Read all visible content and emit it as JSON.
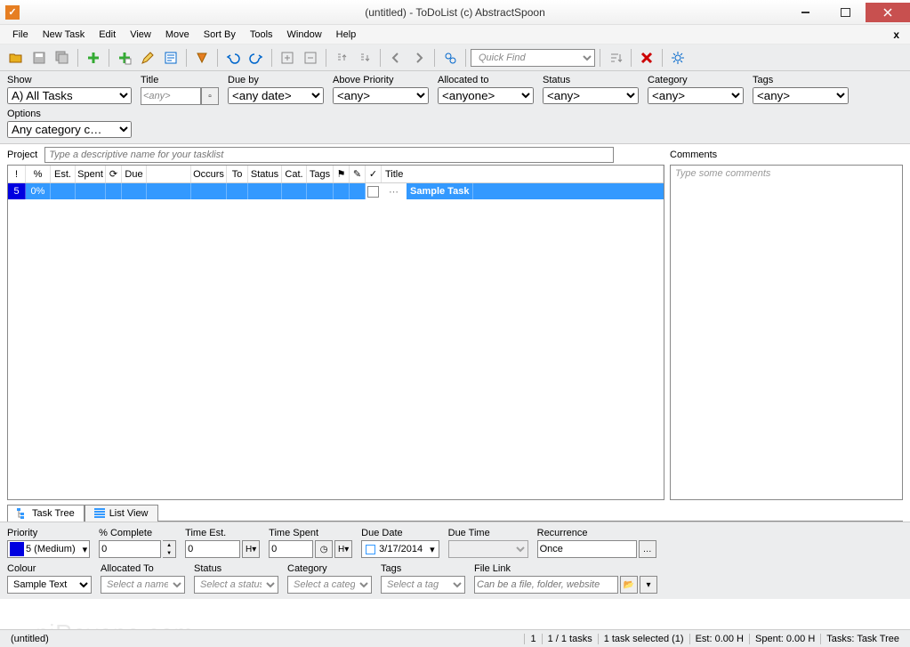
{
  "window": {
    "title": "(untitled) - ToDoList (c) AbstractSpoon"
  },
  "menu": [
    "File",
    "New Task",
    "Edit",
    "View",
    "Move",
    "Sort By",
    "Tools",
    "Window",
    "Help"
  ],
  "toolbar": {
    "quickfind_placeholder": "Quick Find"
  },
  "filters": {
    "show": {
      "label": "Show",
      "value": "A)  All Tasks"
    },
    "title": {
      "label": "Title",
      "value": "<any>"
    },
    "dueby": {
      "label": "Due by",
      "value": "<any date>"
    },
    "abovepriority": {
      "label": "Above Priority",
      "value": "<any>"
    },
    "allocatedto": {
      "label": "Allocated to",
      "value": "<anyone>"
    },
    "status": {
      "label": "Status",
      "value": "<any>"
    },
    "category": {
      "label": "Category",
      "value": "<any>"
    },
    "tags": {
      "label": "Tags",
      "value": "<any>"
    },
    "options": {
      "label": "Options",
      "value": "Any category c…"
    }
  },
  "project": {
    "label": "Project",
    "placeholder": "Type a descriptive name for your tasklist"
  },
  "comments": {
    "label": "Comments",
    "placeholder": "Type some comments"
  },
  "task_columns": [
    "!",
    "%",
    "Est.",
    "Spent",
    "⟳",
    "Due",
    "Occurs",
    "To",
    "Status",
    "Cat.",
    "Tags",
    "⎙",
    "🔒",
    "✓",
    "Title"
  ],
  "task_row": {
    "priority": "5",
    "percent": "0%",
    "title": "Sample Task"
  },
  "tabs": {
    "tree": "Task Tree",
    "list": "List View"
  },
  "props": {
    "priority": {
      "label": "Priority",
      "value": "5 (Medium)"
    },
    "pcomplete": {
      "label": "% Complete",
      "value": "0"
    },
    "timeest": {
      "label": "Time Est.",
      "value": "0",
      "unit": "H"
    },
    "timespent": {
      "label": "Time Spent",
      "value": "0",
      "unit": "H"
    },
    "duedate": {
      "label": "Due Date",
      "value": "3/17/2014"
    },
    "duetime": {
      "label": "Due Time",
      "value": ""
    },
    "recurrence": {
      "label": "Recurrence",
      "value": "Once"
    },
    "colour": {
      "label": "Colour",
      "value": "Sample Text"
    },
    "allocatedto": {
      "label": "Allocated To",
      "placeholder": "Select a name"
    },
    "status": {
      "label": "Status",
      "placeholder": "Select a status"
    },
    "category": {
      "label": "Category",
      "placeholder": "Select a catego"
    },
    "tags": {
      "label": "Tags",
      "placeholder": "Select a tag"
    },
    "filelink": {
      "label": "File Link",
      "placeholder": "Can be a file, folder, website"
    }
  },
  "statusbar": {
    "doc": "(untitled)",
    "page": "1",
    "tasks": "1 / 1 tasks",
    "selected": "1 task selected (1)",
    "est": "Est: 0.00 H",
    "spent": "Spent: 0.00 H",
    "view": "Tasks: Task Tree"
  }
}
